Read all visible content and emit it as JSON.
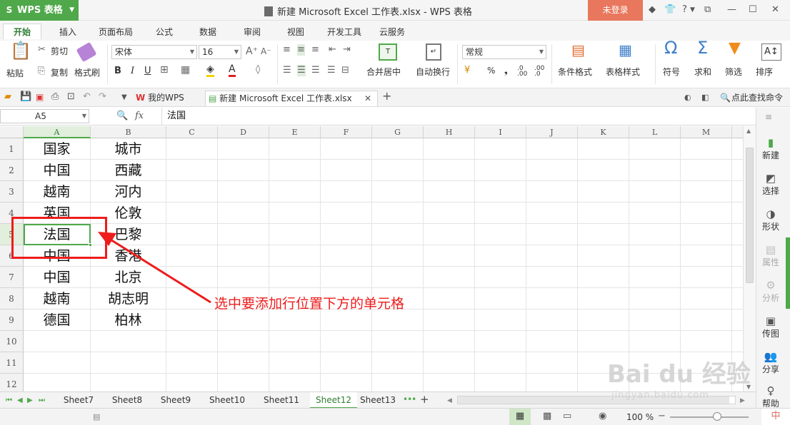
{
  "titlebar": {
    "app_name": "WPS 表格",
    "doc_title": "新建 Microsoft Excel 工作表.xlsx - WPS 表格",
    "login": "未登录"
  },
  "ribbon_tabs": [
    "开始",
    "插入",
    "页面布局",
    "公式",
    "数据",
    "审阅",
    "视图",
    "开发工具",
    "云服务"
  ],
  "ribbon": {
    "paste": "粘贴",
    "cut": "剪切",
    "copy": "复制",
    "format_painter": "格式刷",
    "font_name": "宋体",
    "font_size": "16",
    "merge_center": "合并居中",
    "wrap": "自动换行",
    "number_format": "常规",
    "conditional_format": "条件格式",
    "table_style": "表格样式",
    "symbol": "符号",
    "sum": "求和",
    "filter": "筛选",
    "sort": "排序",
    "bold": "B",
    "italic": "I",
    "underline": "U",
    "percent": "%",
    "comma": "❟"
  },
  "doc_tabs": {
    "home": "我的WPS",
    "file": "新建 Microsoft Excel 工作表.xlsx",
    "search_cmd": "点此查找命令"
  },
  "formula_bar": {
    "name_box": "A5",
    "fx": "fx",
    "content": "法国"
  },
  "columns": [
    "A",
    "B",
    "C",
    "D",
    "E",
    "F",
    "G",
    "H",
    "I",
    "J",
    "K",
    "L",
    "M"
  ],
  "rows": [
    {
      "num": "1",
      "a": "国家",
      "b": "城市"
    },
    {
      "num": "2",
      "a": "中国",
      "b": "西藏"
    },
    {
      "num": "3",
      "a": "越南",
      "b": "河内"
    },
    {
      "num": "4",
      "a": "英国",
      "b": "伦敦"
    },
    {
      "num": "5",
      "a": "法国",
      "b": "巴黎"
    },
    {
      "num": "6",
      "a": "中国",
      "b": "香港"
    },
    {
      "num": "7",
      "a": "中国",
      "b": "北京"
    },
    {
      "num": "8",
      "a": "越南",
      "b": "胡志明"
    },
    {
      "num": "9",
      "a": "德国",
      "b": "柏林"
    },
    {
      "num": "10",
      "a": "",
      "b": ""
    },
    {
      "num": "11",
      "a": "",
      "b": ""
    },
    {
      "num": "12",
      "a": "",
      "b": ""
    }
  ],
  "annotation": "选中要添加行位置下方的单元格",
  "sheets": [
    "Sheet7",
    "Sheet8",
    "Sheet9",
    "Sheet10",
    "Sheet11",
    "Sheet12",
    "Sheet13"
  ],
  "active_sheet": "Sheet12",
  "side_panel": [
    "新建",
    "选择",
    "形状",
    "属性",
    "分析",
    "传图",
    "分享",
    "帮助"
  ],
  "status": {
    "zoom": "100 %",
    "ime": "中"
  },
  "watermark": {
    "brand": "Bai du 经验",
    "url": "jingyan.baidu.com"
  },
  "colors": {
    "wps_green": "#4fa84a",
    "login_orange": "#e8775d",
    "annotation_red": "#ee1c1c"
  }
}
